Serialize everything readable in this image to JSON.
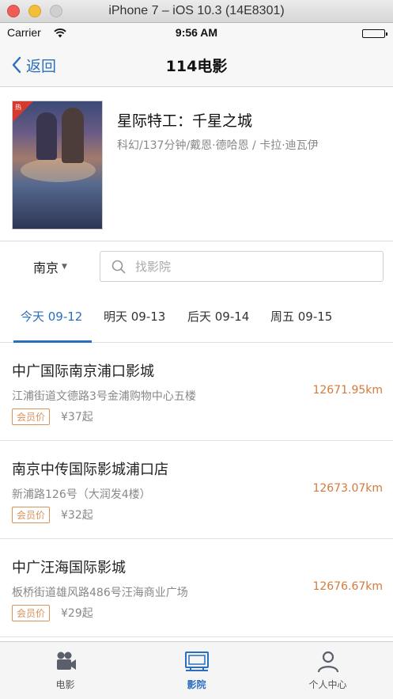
{
  "simulator": {
    "title": "iPhone 7 – iOS 10.3 (14E8301)"
  },
  "status_bar": {
    "carrier": "Carrier",
    "time": "9:56 AM"
  },
  "navbar": {
    "back_label": "返回",
    "title": "114电影"
  },
  "movie": {
    "name": "星际特工：千星之城",
    "meta": "科幻/137分钟/戴恩·德哈恩 / 卡拉·迪瓦伊",
    "poster_badge": "热"
  },
  "search": {
    "city": "南京",
    "placeholder": "找影院"
  },
  "date_tabs": [
    {
      "label": "今天 09-12",
      "active": true
    },
    {
      "label": "明天 09-13",
      "active": false
    },
    {
      "label": "后天 09-14",
      "active": false
    },
    {
      "label": "周五 09-15",
      "active": false
    }
  ],
  "cinemas": [
    {
      "name": "中广国际南京浦口影城",
      "address": "江浦街道文德路3号金浦购物中心五楼",
      "distance": "12671.95km",
      "badge": "会员价",
      "price": "¥37起"
    },
    {
      "name": "南京中传国际影城浦口店",
      "address": "新浦路126号（大润发4楼）",
      "distance": "12673.07km",
      "badge": "会员价",
      "price": "¥32起"
    },
    {
      "name": "中广汪海国际影城",
      "address": "板桥街道雄风路486号汪海商业广场",
      "distance": "12676.67km",
      "badge": "会员价",
      "price": "¥29起"
    }
  ],
  "tabbar": {
    "items": [
      {
        "label": "电影",
        "icon": "movie-camera-icon",
        "active": false
      },
      {
        "label": "影院",
        "icon": "cinema-screen-icon",
        "active": true
      },
      {
        "label": "个人中心",
        "icon": "person-icon",
        "active": false
      }
    ]
  },
  "colors": {
    "accent": "#2a6ebd",
    "distance": "#d57a3a",
    "badge": "#d8925a"
  }
}
